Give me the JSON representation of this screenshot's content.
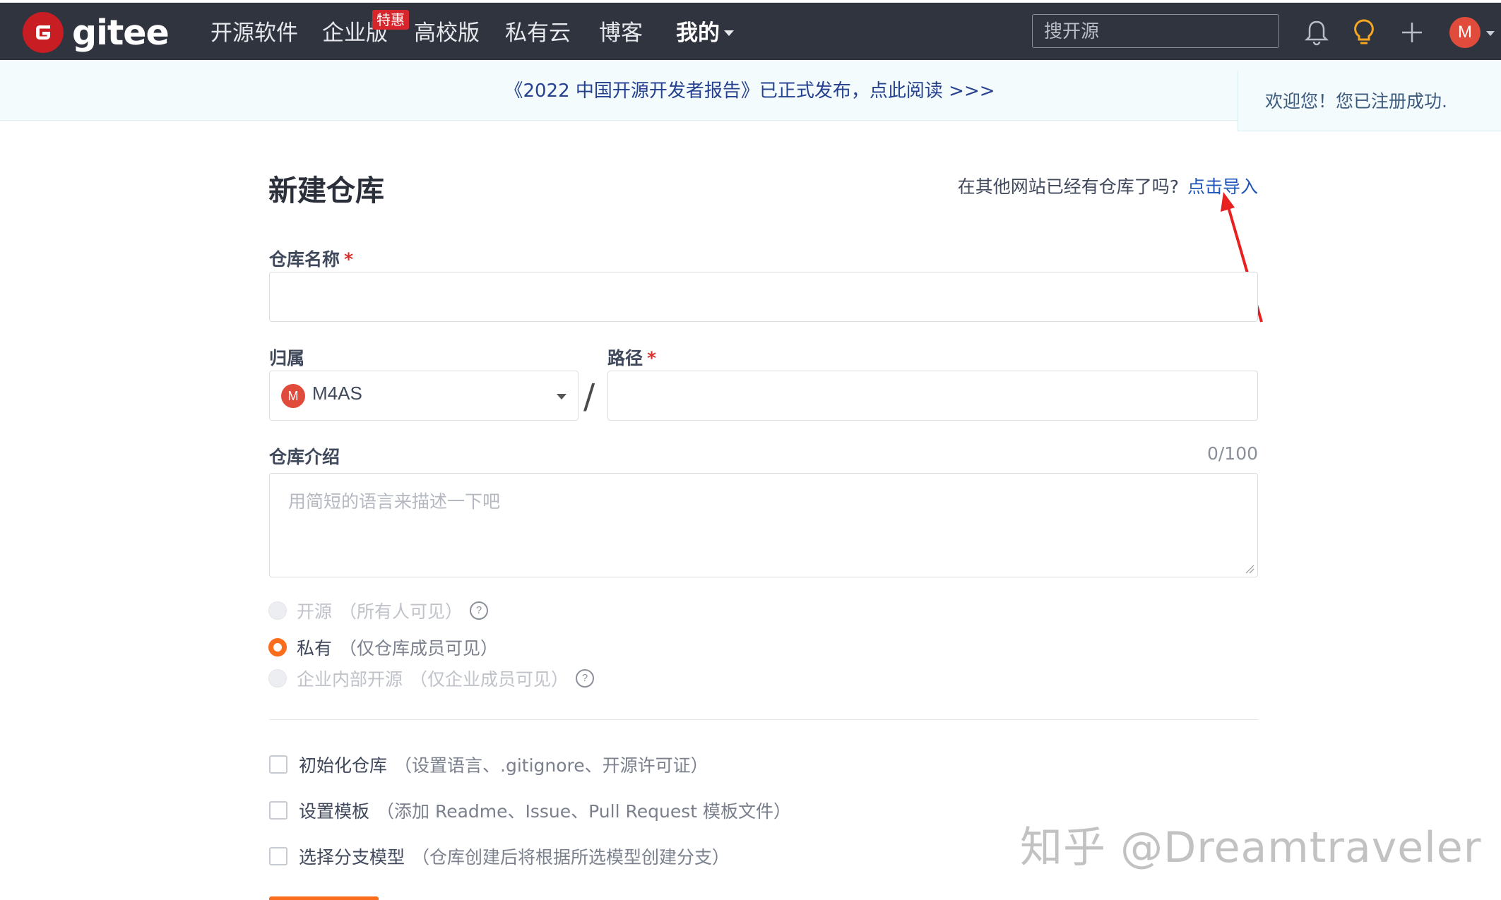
{
  "nav": {
    "logo_text": "gitee",
    "items": [
      "开源软件",
      "企业版",
      "高校版",
      "私有云",
      "博客"
    ],
    "enterprise_badge": "特惠",
    "mine": "我的",
    "search_placeholder": "搜开源",
    "avatar_letter": "M",
    "icons": [
      "bell-icon",
      "lightbulb-icon",
      "plus-icon"
    ]
  },
  "announcement": "《2022 中国开源开发者报告》已正式发布，点此阅读 >>>",
  "toast": "欢迎您！您已注册成功.",
  "form": {
    "title": "新建仓库",
    "import_prompt": "在其他网站已经有仓库了吗?",
    "import_link": "点击导入",
    "name_label": "仓库名称",
    "required_mark": "*",
    "owner_label": "归属",
    "owner_avatar": "M",
    "owner_value": "M4AS",
    "separator": "/",
    "path_label": "路径",
    "desc_label": "仓库介绍",
    "desc_counter": "0/100",
    "desc_placeholder": "用简短的语言来描述一下吧",
    "visibility": [
      {
        "label": "开源",
        "hint": "（所有人可见）",
        "selected": false,
        "disabled": true,
        "help": "?"
      },
      {
        "label": "私有",
        "hint": "（仅仓库成员可见）",
        "selected": true,
        "disabled": false
      },
      {
        "label": "企业内部开源",
        "hint": "（仅企业成员可见）",
        "selected": false,
        "disabled": true,
        "help": "?"
      }
    ],
    "options": [
      {
        "label": "初始化仓库",
        "hint": "（设置语言、.gitignore、开源许可证）"
      },
      {
        "label": "设置模板",
        "hint": "（添加 Readme、Issue、Pull Request 模板文件）"
      },
      {
        "label": "选择分支模型",
        "hint": "（仓库创建后将根据所选模型创建分支）"
      }
    ]
  },
  "watermark": "知乎 @Dreamtraveler",
  "colors": {
    "nav_bg": "#30343f",
    "brand_red": "#c71d23",
    "accent_orange": "#fa6d1d",
    "link_blue": "#1f56b8",
    "annotation_arrow": "#e8201f"
  }
}
